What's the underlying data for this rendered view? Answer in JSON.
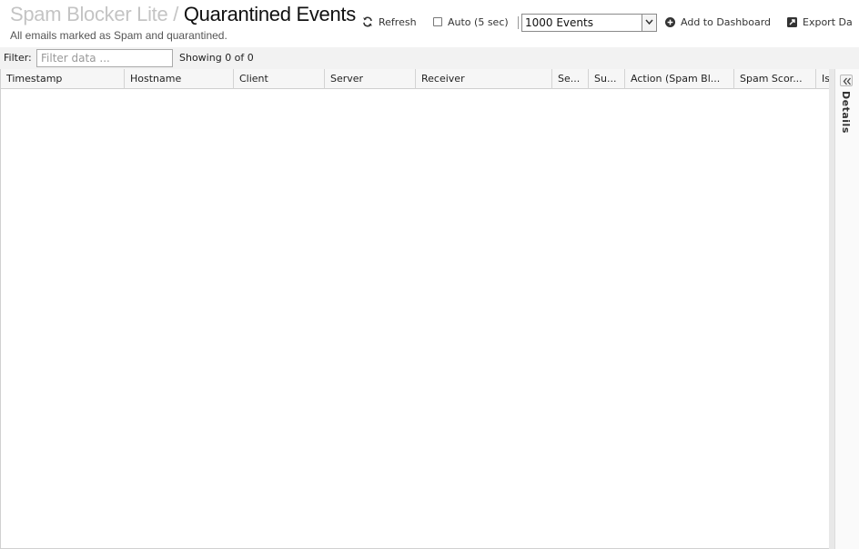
{
  "header": {
    "breadcrumb": "Spam Blocker Lite",
    "separator": "/",
    "title": "Quarantined Events",
    "subtitle": "All emails marked as Spam and quarantined."
  },
  "toolbar": {
    "refresh_label": "Refresh",
    "auto_label": "Auto (5 sec)",
    "auto_checked": false,
    "events_select_value": "1000 Events",
    "add_dashboard_label": "Add to Dashboard",
    "export_label": "Export Da"
  },
  "filter": {
    "label": "Filter:",
    "placeholder": "Filter data ...",
    "value": "",
    "showing_text": "Showing 0 of 0"
  },
  "grid": {
    "columns": [
      "Timestamp",
      "Hostname",
      "Client",
      "Server",
      "Receiver",
      "Se...",
      "Su...",
      "Action (Spam Bl...",
      "Spam Scor...",
      "Is"
    ],
    "rows": []
  },
  "details_panel": {
    "label": "Details"
  }
}
